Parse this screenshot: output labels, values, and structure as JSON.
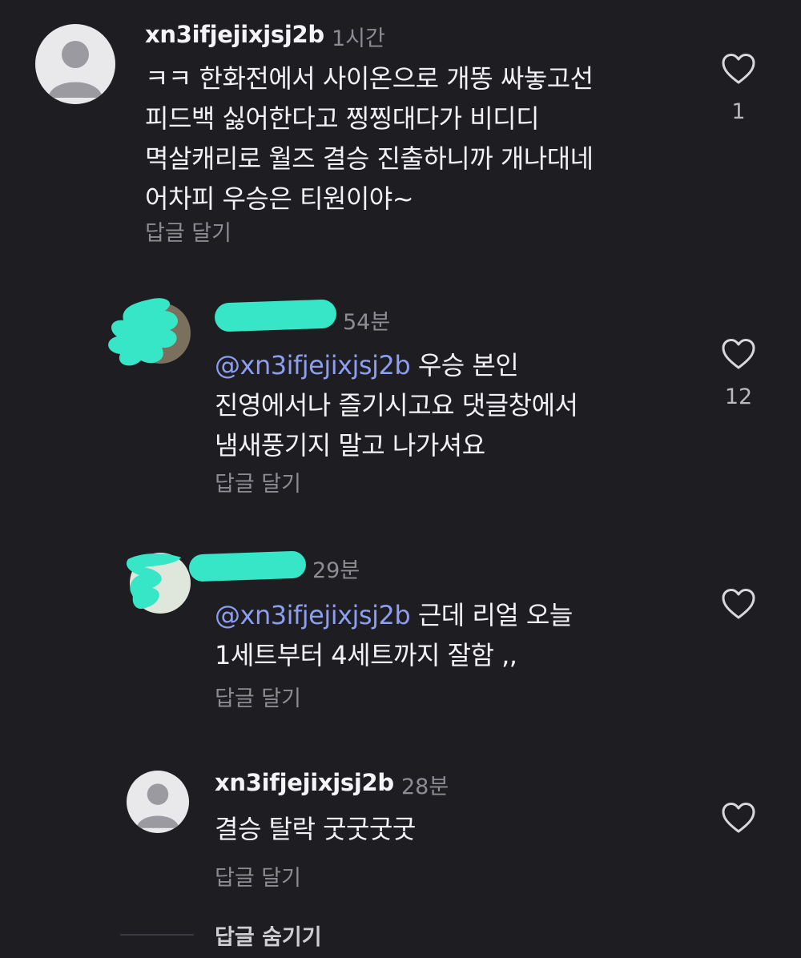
{
  "comments": [
    {
      "username": "xn3ifjejixjsj2b",
      "time": "1시간",
      "lines": [
        "ㅋㅋ 한화전에서 사이온으로 개똥 싸놓고선",
        "피드백 싫어한다고 찡찡대다가 비디디",
        "멱살캐리로 월즈 결승 진출하니까 개나대네",
        "어차피 우승은 티원이야~"
      ],
      "reply_label": "답글 달기",
      "likes": "1"
    },
    {
      "username": "",
      "time": "54분",
      "mention": "@xn3ifjejixjsj2b",
      "lines": [
        " 우승 본인",
        "진영에서나 즐기시고요 댓글창에서",
        "냄새풍기지 말고 나가셔요"
      ],
      "reply_label": "답글 달기",
      "likes": "12"
    },
    {
      "username": "",
      "time": "29분",
      "mention": "@xn3ifjejixjsj2b",
      "lines": [
        " 근데 리얼 오늘",
        "1세트부터 4세트까지 잘함 ,,"
      ],
      "reply_label": "답글 달기",
      "likes": ""
    },
    {
      "username": "xn3ifjejixjsj2b",
      "time": "28분",
      "lines": [
        "결승 탈락 굿굿굿굿"
      ],
      "reply_label": "답글 달기",
      "likes": ""
    }
  ],
  "hide_replies_label": "답글 숨기기",
  "icons": {
    "like": "heart-outline-icon",
    "avatar": "default-avatar-icon"
  },
  "colors": {
    "background": "#1e1e22",
    "mention": "#8d9ef0",
    "redaction": "#36e6c6"
  }
}
